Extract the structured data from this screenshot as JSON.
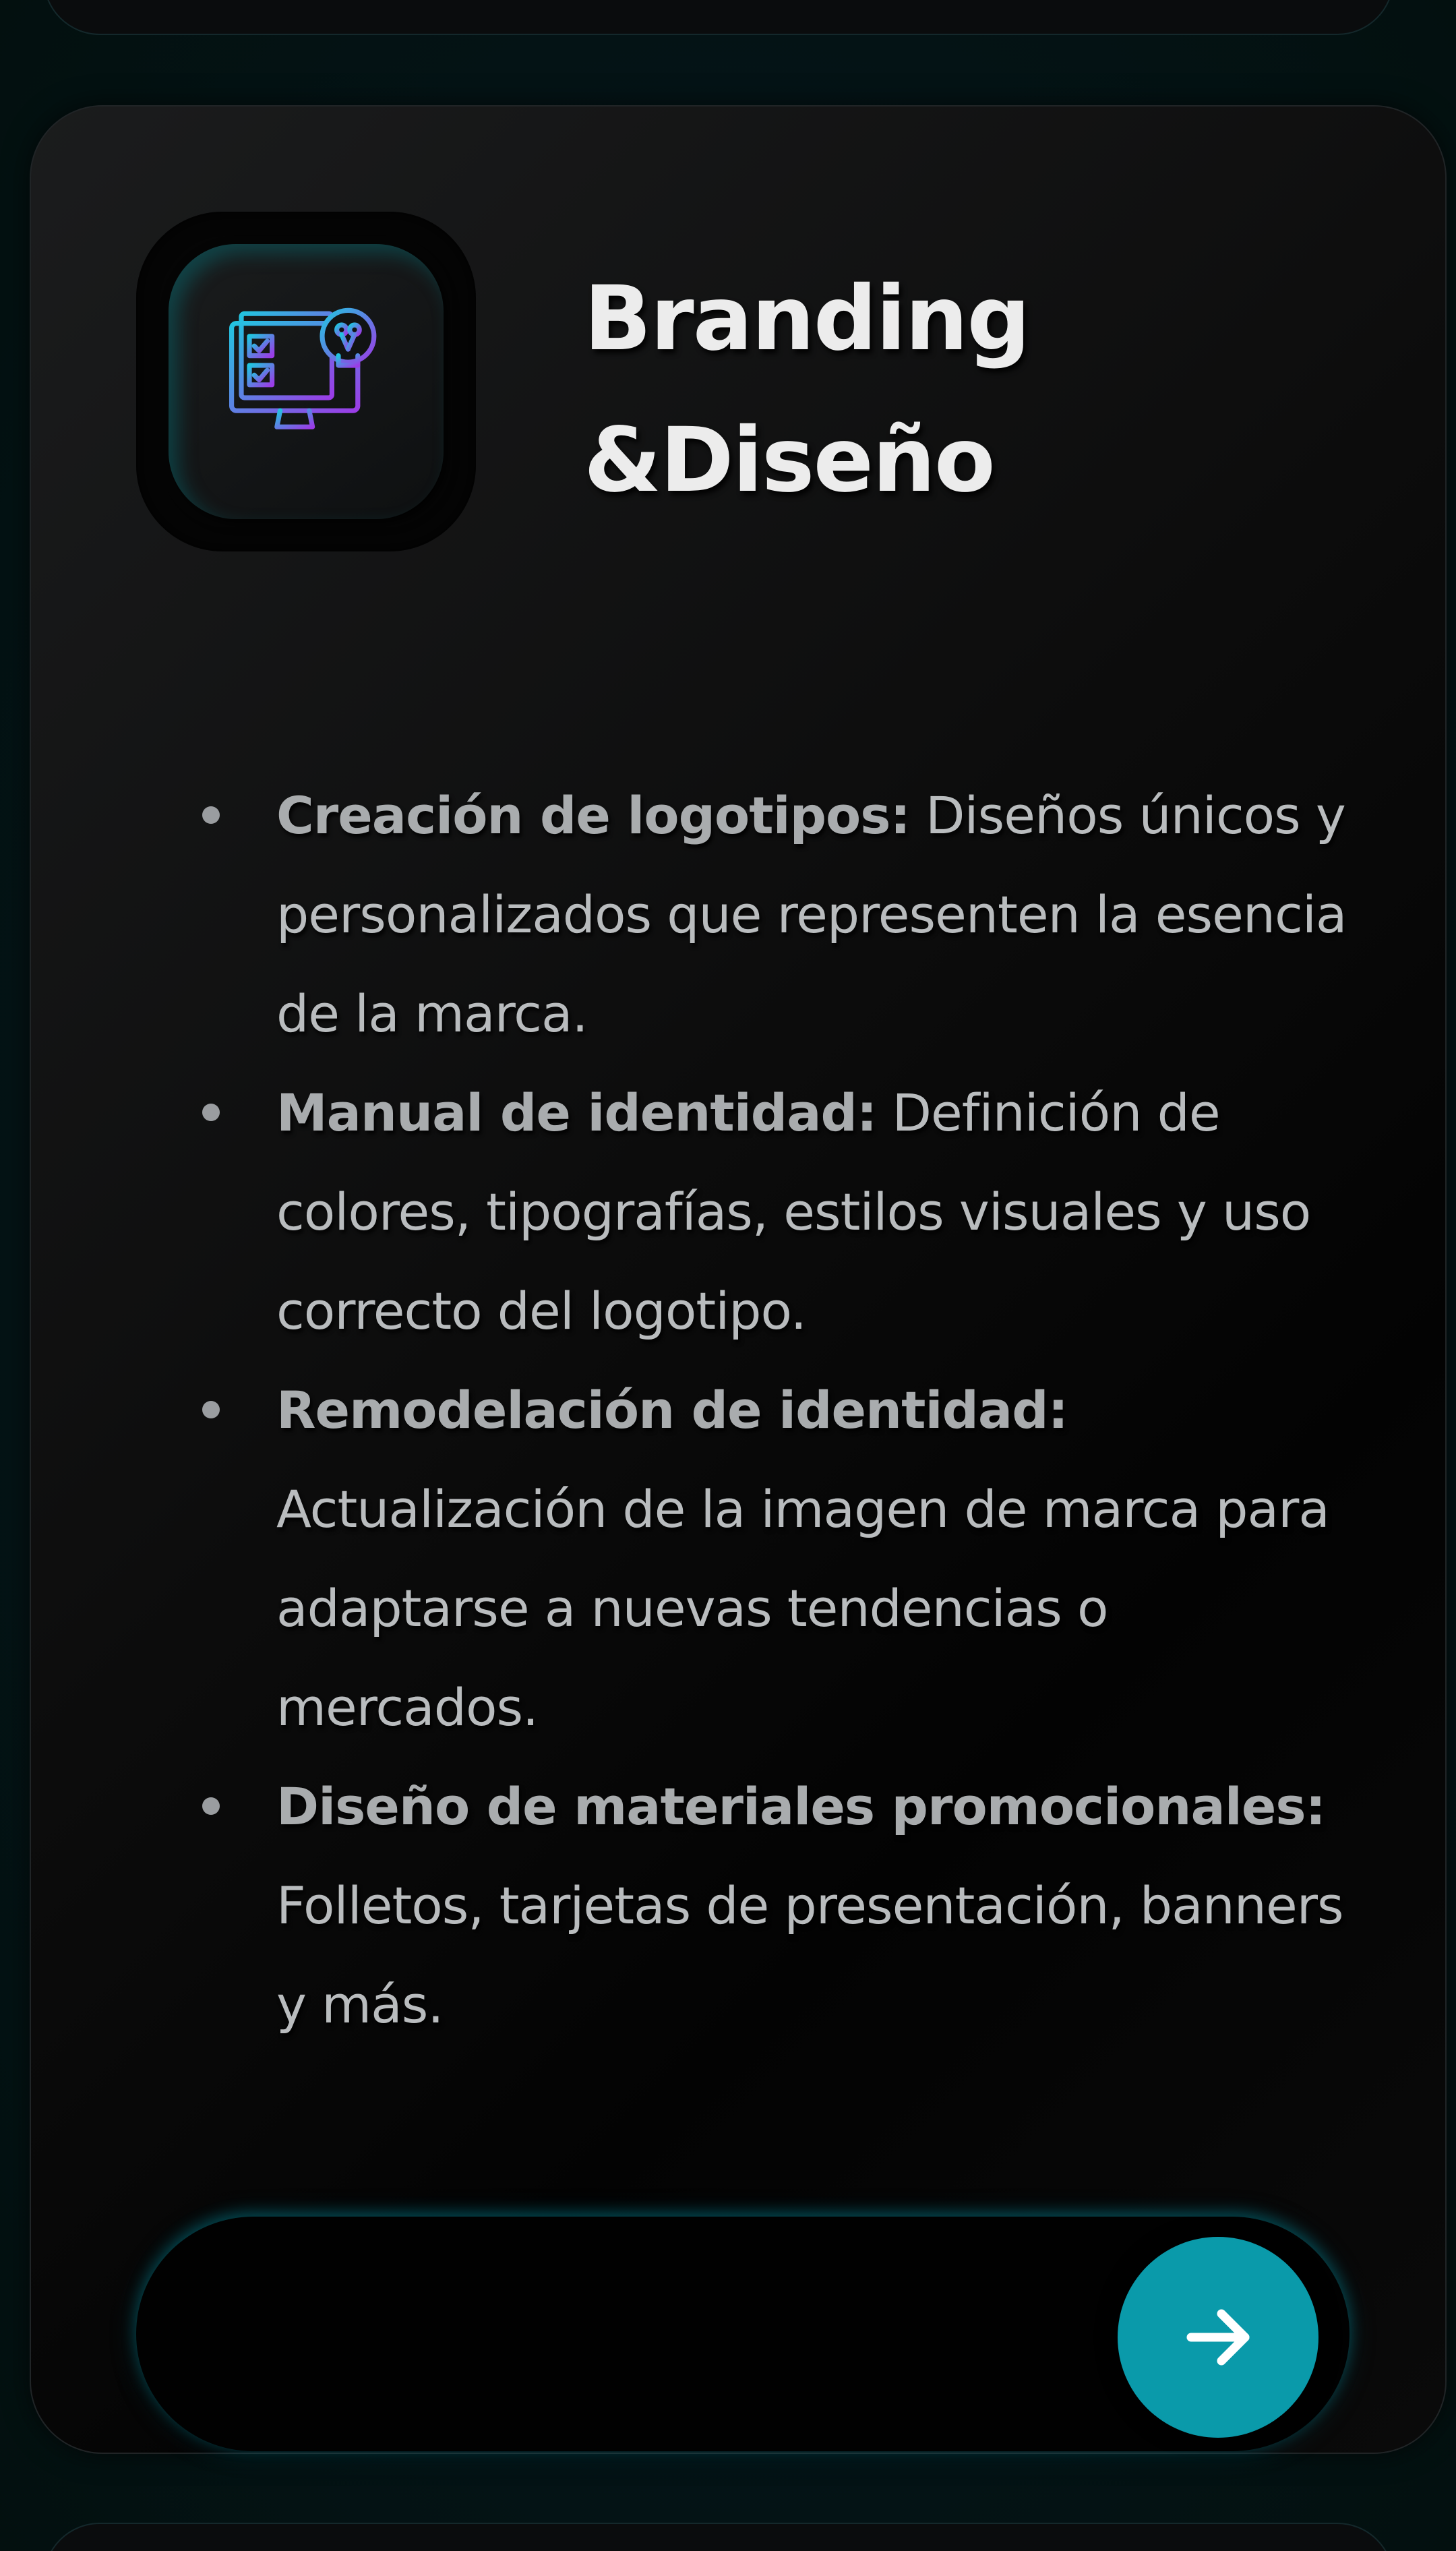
{
  "card": {
    "icon": "branding-design-monitor-icon",
    "title_line1": "Branding",
    "title_line2": "&Diseño",
    "items": [
      {
        "term": "Creación de logotipos:",
        "description": " Diseños únicos y personalizados que representen la esencia de la marca."
      },
      {
        "term": "Manual de identidad:",
        "description": " Definición de colores, tipografías, estilos visuales y uso correcto del logotipo."
      },
      {
        "term": "Remodelación de identidad:",
        "description": " Actualización de la imagen de marca para adaptarse a nuevas tendencias o mercados."
      },
      {
        "term": "Diseño de materiales promocionales:",
        "description": " Folletos, tarjetas de presentación, banners y más."
      }
    ],
    "action_icon": "arrow-right-icon"
  },
  "colors": {
    "accent": "#0a9aaa",
    "background": "#041417",
    "card": "#0c0c0c",
    "title": "#ececec",
    "text": "#b9bcbe"
  }
}
